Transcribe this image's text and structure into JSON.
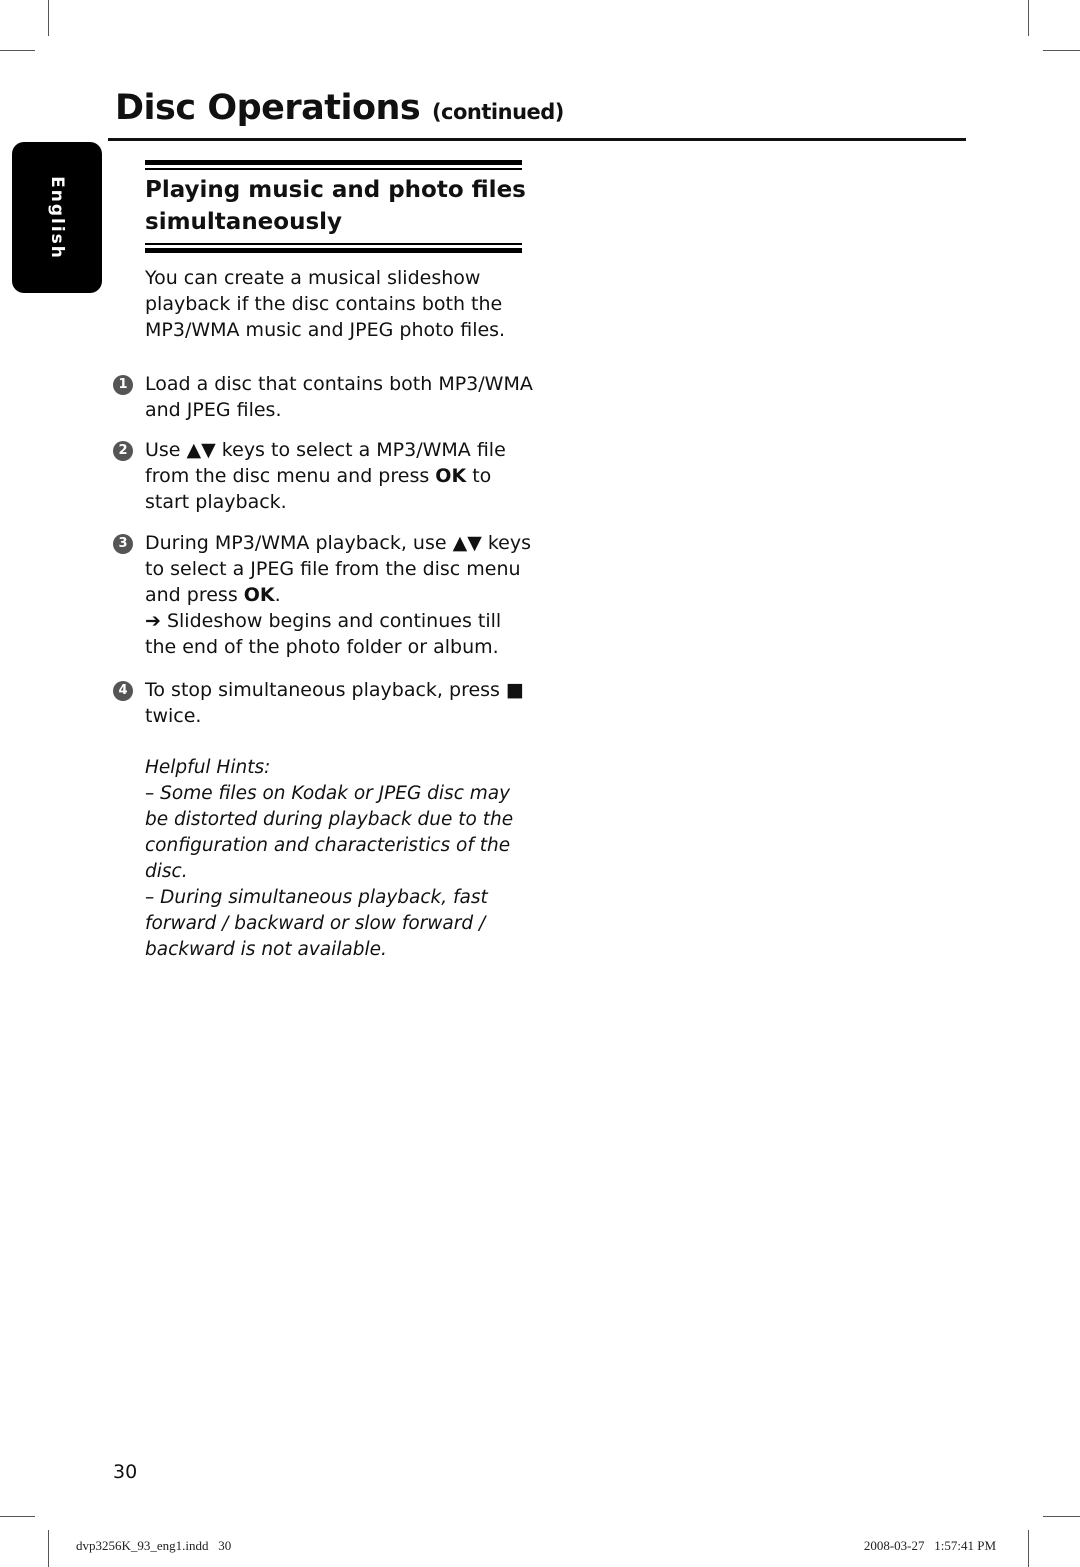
{
  "page": {
    "title": "Disc Operations",
    "title_suffix": "(continued)",
    "language_tab": "English"
  },
  "section": {
    "title": "Playing music and photo files simultaneously",
    "intro": "You can create a musical slideshow playback if the disc contains both the MP3/WMA music and JPEG photo files."
  },
  "steps": [
    {
      "number": "1",
      "text": "Load a disc that contains both MP3/WMA and JPEG files."
    },
    {
      "number": "2",
      "before": "Use ▲▼ keys to select a MP3/WMA file from the disc menu and press ",
      "bold": "OK",
      "after": " to start playback."
    },
    {
      "number": "3",
      "before": "During MP3/WMA playback, use ▲▼ keys to select a JPEG file from the disc menu and press ",
      "bold": "OK",
      "after": ".",
      "result": "➔ Slideshow begins and continues till the end of the photo folder or album."
    },
    {
      "number": "4",
      "text": "To stop simultaneous playback, press ■ twice."
    }
  ],
  "hints": {
    "heading": "Helpful Hints:",
    "items": [
      "–  Some files on Kodak or JPEG disc may be distorted during playback due to the configuration and characteristics of the disc.",
      "–  During simultaneous playback, fast forward / backward or slow forward / backward is not available."
    ]
  },
  "page_number": "30",
  "footer": {
    "file": "dvp3256K_93_eng1.indd   30",
    "timestamp": "2008-03-27   1:57:41 PM"
  }
}
